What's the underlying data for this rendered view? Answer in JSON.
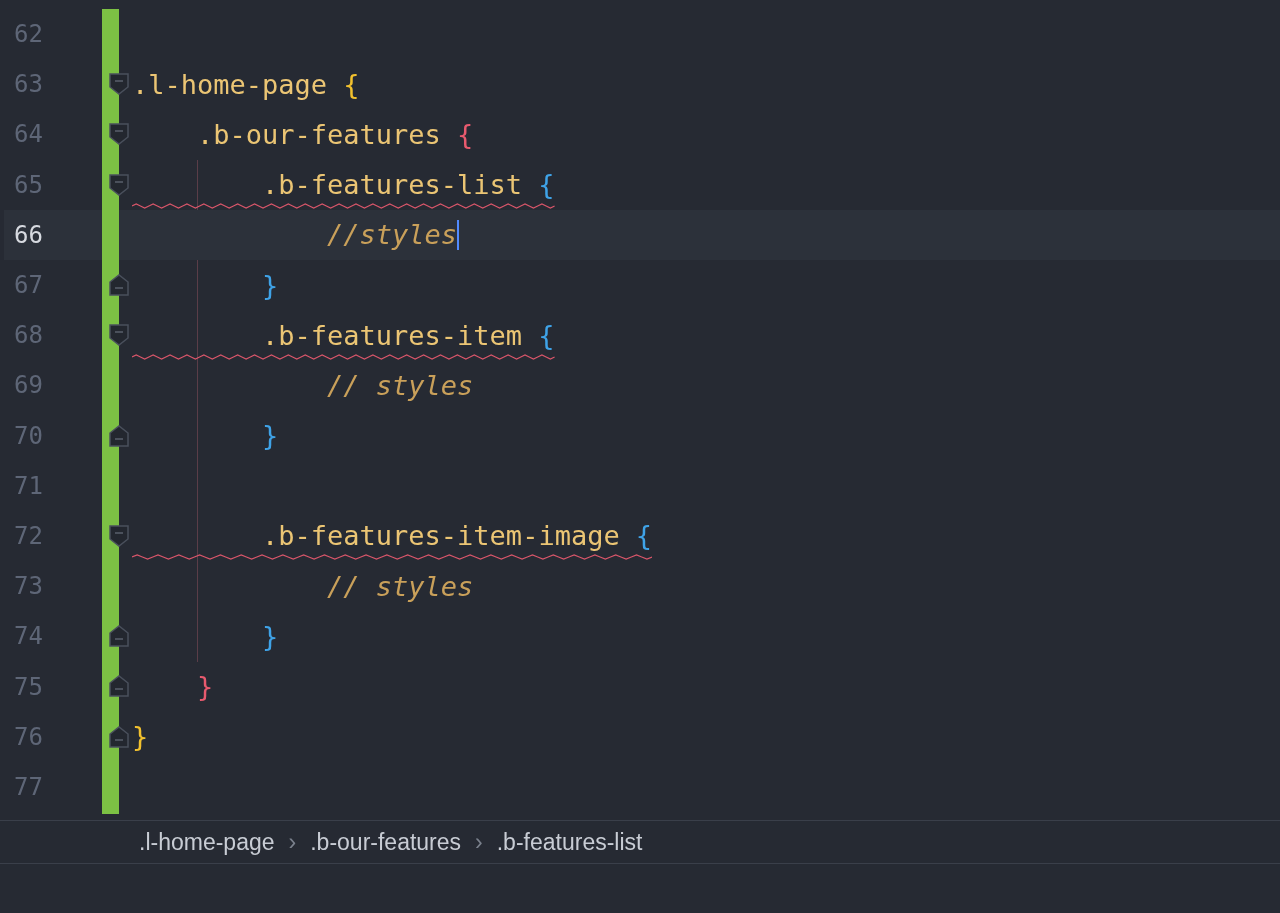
{
  "lines": [
    {
      "number": "62",
      "current": false,
      "kind": "plain"
    },
    {
      "number": "63",
      "current": false,
      "kind": "fold-start",
      "tokens": [
        {
          "kind": "selector",
          "text": ".l-home-page"
        },
        {
          "kind": "brace",
          "text": "{",
          "color": "#f2c12e"
        }
      ]
    },
    {
      "number": "64",
      "current": false,
      "kind": "fold-start",
      "tokens": [
        {
          "kind": "selector",
          "text": "    .b-our-features"
        },
        {
          "kind": "brace",
          "text": "{",
          "color": "#e85a6e"
        }
      ]
    },
    {
      "number": "65",
      "current": false,
      "kind": "fold-start",
      "squiggle": true,
      "tokens": [
        {
          "kind": "selector",
          "text": "        .b-features-list"
        },
        {
          "kind": "brace",
          "text": "{",
          "color": "#3fa3e8"
        }
      ]
    },
    {
      "number": "66",
      "current": true,
      "kind": "plain",
      "tokens": [
        {
          "kind": "comment",
          "text": "            //styles"
        }
      ]
    },
    {
      "number": "67",
      "current": false,
      "kind": "fold-end",
      "tokens": [
        {
          "kind": "brace",
          "text": "        }",
          "color": "#3fa3e8"
        }
      ]
    },
    {
      "number": "68",
      "current": false,
      "kind": "fold-start",
      "squiggle": true,
      "tokens": [
        {
          "kind": "selector",
          "text": "        .b-features-item"
        },
        {
          "kind": "brace",
          "text": "{",
          "color": "#3fa3e8"
        }
      ]
    },
    {
      "number": "69",
      "current": false,
      "kind": "plain",
      "tokens": [
        {
          "kind": "comment",
          "text": "            // styles"
        }
      ]
    },
    {
      "number": "70",
      "current": false,
      "kind": "fold-end",
      "tokens": [
        {
          "kind": "brace",
          "text": "        }",
          "color": "#3fa3e8"
        }
      ]
    },
    {
      "number": "71",
      "current": false,
      "kind": "plain"
    },
    {
      "number": "72",
      "current": false,
      "kind": "fold-start",
      "squiggle": true,
      "tokens": [
        {
          "kind": "selector",
          "text": "        .b-features-item-image"
        },
        {
          "kind": "brace",
          "text": "{",
          "color": "#3fa3e8"
        }
      ]
    },
    {
      "number": "73",
      "current": false,
      "kind": "plain",
      "tokens": [
        {
          "kind": "comment",
          "text": "            // styles"
        }
      ]
    },
    {
      "number": "74",
      "current": false,
      "kind": "fold-end",
      "tokens": [
        {
          "kind": "brace",
          "text": "        }",
          "color": "#3fa3e8"
        }
      ]
    },
    {
      "number": "75",
      "current": false,
      "kind": "fold-end",
      "tokens": [
        {
          "kind": "brace",
          "text": "    }",
          "color": "#e85a6e"
        }
      ]
    },
    {
      "number": "76",
      "current": false,
      "kind": "fold-end",
      "tokens": [
        {
          "kind": "brace",
          "text": "}",
          "color": "#f2c12e"
        }
      ]
    },
    {
      "number": "77",
      "current": false,
      "kind": "plain"
    }
  ],
  "breadcrumbs": [
    {
      "label": ".l-home-page"
    },
    {
      "label": ".b-our-features"
    },
    {
      "label": ".b-features-list"
    }
  ],
  "breadcrumb_separator": "›"
}
